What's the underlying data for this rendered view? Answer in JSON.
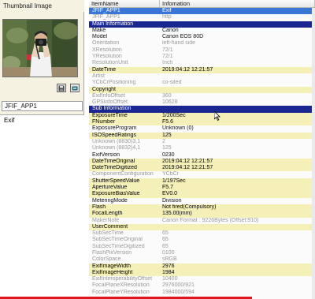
{
  "left": {
    "thumbnail_title": "Thumbnail Image",
    "icons": [
      "save-icon",
      "copy-icon"
    ],
    "section_label": "JFIF_APP1",
    "sub_items": [
      "Exif"
    ]
  },
  "table": {
    "headers": {
      "item": "ItemName",
      "info": "Infomation"
    },
    "rows": [
      {
        "name": "JFIF_APP1",
        "value": "Exif",
        "style": "sel"
      },
      {
        "name": "JFIF_APP1",
        "value": "http",
        "style": "dim"
      },
      {
        "name": "Main Information",
        "value": "",
        "style": "group"
      },
      {
        "name": "Make",
        "value": "Canon",
        "style": "normal"
      },
      {
        "name": "Model",
        "value": "Canon EOS 80D",
        "style": "normal"
      },
      {
        "name": "Orientation",
        "value": "left-hand side",
        "style": "dim"
      },
      {
        "name": "XResolution",
        "value": "72/1",
        "style": "dim"
      },
      {
        "name": "YResolution",
        "value": "72/1",
        "style": "dim"
      },
      {
        "name": "ResolutionUnit",
        "value": "Inch",
        "style": "dim"
      },
      {
        "name": "DateTime",
        "value": "2019:04:12 12:21:57",
        "style": "hl"
      },
      {
        "name": "Artist",
        "value": "",
        "style": "dim"
      },
      {
        "name": "YCbCrPositioning",
        "value": "co-sited",
        "style": "dim"
      },
      {
        "name": "Copyright",
        "value": "",
        "style": "hl"
      },
      {
        "name": "ExifInfoOffset",
        "value": "360",
        "style": "dim"
      },
      {
        "name": "GPSInfoOffset",
        "value": "10628",
        "style": "dim"
      },
      {
        "name": "Sub Information",
        "value": "",
        "style": "group"
      },
      {
        "name": "ExposureTime",
        "value": "1/200Sec",
        "style": "hl"
      },
      {
        "name": "FNumber",
        "value": "F5.6",
        "style": "hl"
      },
      {
        "name": "ExposureProgram",
        "value": "Unknown (0)",
        "style": "normal"
      },
      {
        "name": "ISOSpeedRatings",
        "value": "125",
        "style": "hl"
      },
      {
        "name": "Unknown (8830)3,1",
        "value": "2",
        "style": "dim"
      },
      {
        "name": "Unknown (8832)4,1",
        "value": "125",
        "style": "dim"
      },
      {
        "name": "ExifVersion",
        "value": "0230",
        "style": "normal"
      },
      {
        "name": "DateTimeOriginal",
        "value": "2019:04:12 12:21:57",
        "style": "hl"
      },
      {
        "name": "DateTimeDigitized",
        "value": "2019:04:12 12:21:57",
        "style": "hl"
      },
      {
        "name": "ComponentConfiguration",
        "value": "YCbCr",
        "style": "dim"
      },
      {
        "name": "ShutterSpeedValue",
        "value": "1/197Sec",
        "style": "hl"
      },
      {
        "name": "ApertureValue",
        "value": "F5.7",
        "style": "hl"
      },
      {
        "name": "ExposureBiasValue",
        "value": "EV0.0",
        "style": "hl"
      },
      {
        "name": "MeteringMode",
        "value": "Division",
        "style": "normal"
      },
      {
        "name": "Flash",
        "value": "Not fired(Compulsory)",
        "style": "hl"
      },
      {
        "name": "FocalLength",
        "value": "135.00(mm)",
        "style": "hl"
      },
      {
        "name": "MakerNote",
        "value": "Canon Format : 9226Bytes (Offset:910)",
        "style": "dim"
      },
      {
        "name": "UserComment",
        "value": "",
        "style": "hl"
      },
      {
        "name": "SubSecTime",
        "value": "65",
        "style": "dim"
      },
      {
        "name": "SubSecTimeOriginal",
        "value": "65",
        "style": "dim"
      },
      {
        "name": "SubSecTimeDigitized",
        "value": "65",
        "style": "dim"
      },
      {
        "name": "FlashPixVersion",
        "value": "0100",
        "style": "dim"
      },
      {
        "name": "ColorSpace",
        "value": "sRGB",
        "style": "dim"
      },
      {
        "name": "ExifImageWidth",
        "value": "2976",
        "style": "hl"
      },
      {
        "name": "ExifImageHeight",
        "value": "1984",
        "style": "hl"
      },
      {
        "name": "ExifInteroperabilityOffset",
        "value": "10400",
        "style": "dim"
      },
      {
        "name": "FocalPlaneXResolution",
        "value": "2976000/921",
        "style": "dim"
      },
      {
        "name": "FocalPlaneYResolution",
        "value": "1984000/594",
        "style": "dim"
      }
    ]
  },
  "colors": {
    "left_bg": "#f6f2e2",
    "highlight_row": "#f5efb8",
    "group_row": "#1a2790",
    "selected_row": "#3a76d6",
    "dim_text": "#9a9a9a",
    "bottom_bar": "#e0161e"
  }
}
